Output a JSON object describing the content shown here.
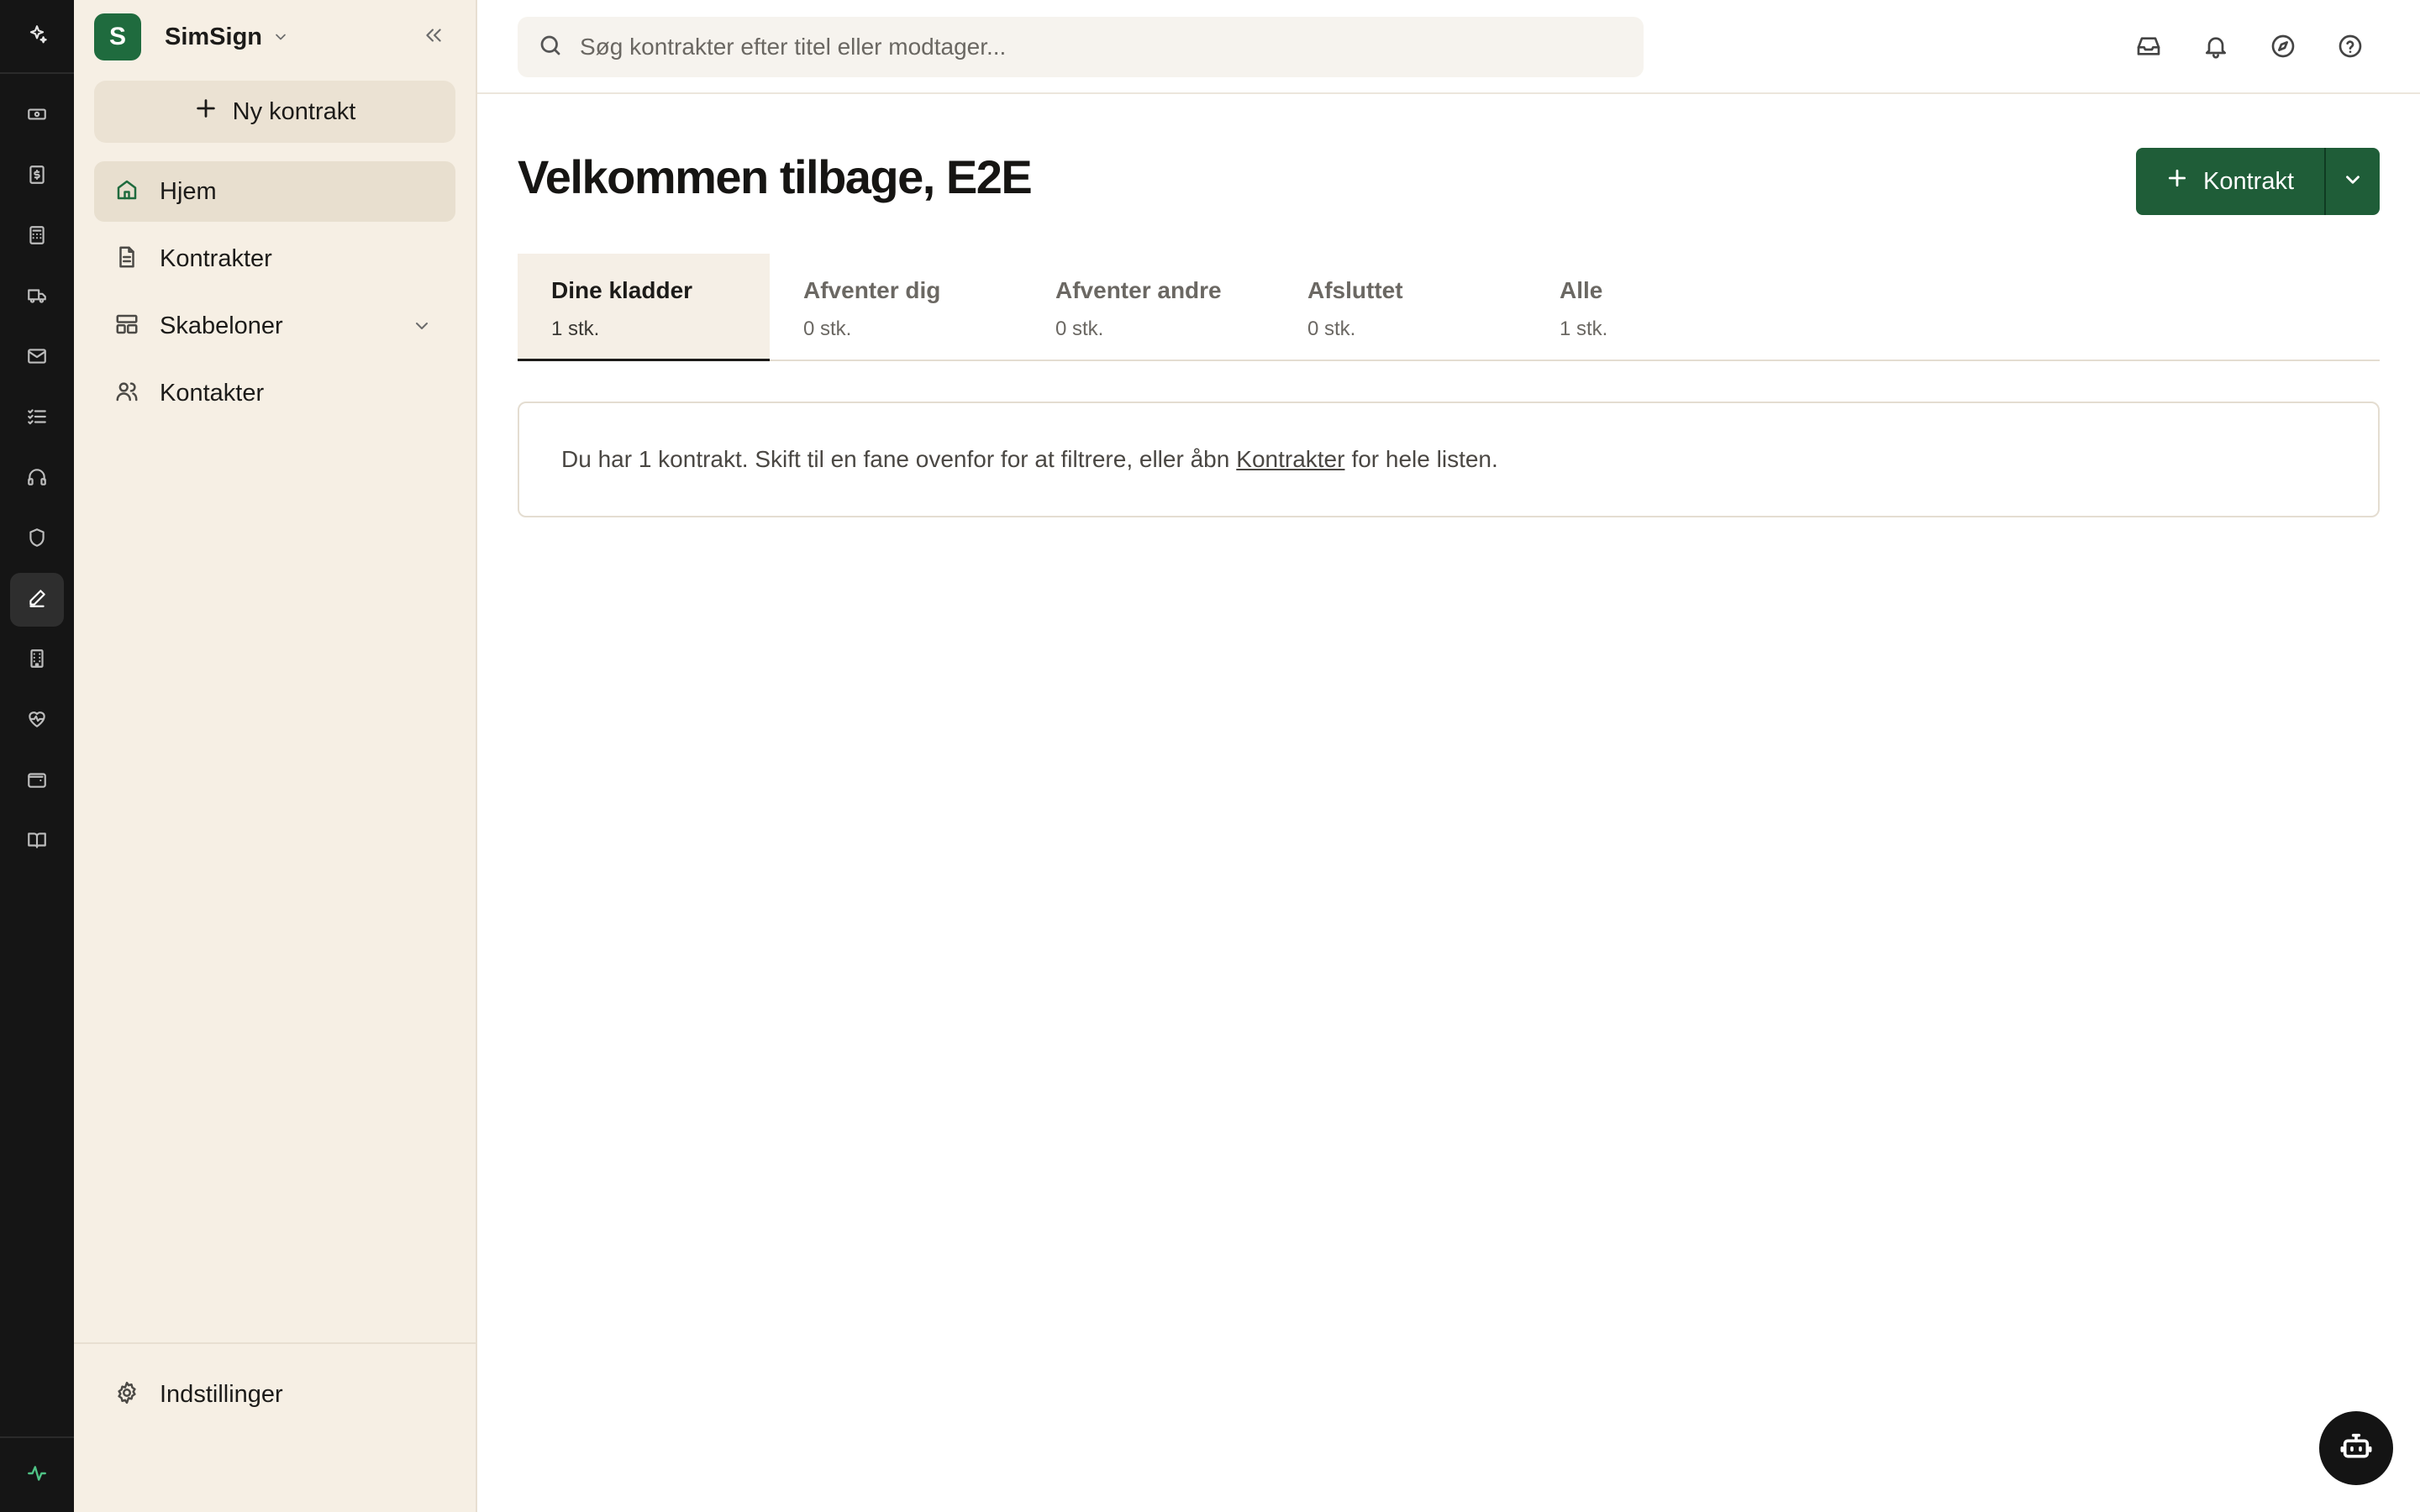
{
  "rail": {
    "logo_icon": "sparkle-icon",
    "items": [
      {
        "name": "banknote-icon"
      },
      {
        "name": "dollar-document-icon"
      },
      {
        "name": "calculator-icon"
      },
      {
        "name": "truck-icon"
      },
      {
        "name": "mail-icon"
      },
      {
        "name": "checklist-icon"
      },
      {
        "name": "headset-icon"
      },
      {
        "name": "shield-icon"
      },
      {
        "name": "pen-icon",
        "active": true
      },
      {
        "name": "building-icon"
      },
      {
        "name": "heart-pulse-icon"
      },
      {
        "name": "wallet-icon"
      },
      {
        "name": "book-icon"
      }
    ],
    "status_icon": "activity-icon",
    "status_color": "#4fc285"
  },
  "sidebar": {
    "workspace_initial": "S",
    "workspace_name": "SimSign",
    "new_button_label": "Ny kontrakt",
    "items": [
      {
        "label": "Hjem",
        "icon": "home-icon",
        "active": true
      },
      {
        "label": "Kontrakter",
        "icon": "document-icon"
      },
      {
        "label": "Skabeloner",
        "icon": "layout-template-icon",
        "expandable": true
      },
      {
        "label": "Kontakter",
        "icon": "users-icon"
      }
    ],
    "settings_label": "Indstillinger"
  },
  "topbar": {
    "search_placeholder": "Søg kontrakter efter titel eller modtager..."
  },
  "main": {
    "title": "Velkommen tilbage, E2E",
    "primary_button_label": "Kontrakt",
    "tabs": [
      {
        "label": "Dine kladder",
        "count": "1 stk.",
        "active": true
      },
      {
        "label": "Afventer dig",
        "count": "0 stk."
      },
      {
        "label": "Afventer andre",
        "count": "0 stk."
      },
      {
        "label": "Afsluttet",
        "count": "0 stk."
      },
      {
        "label": "Alle",
        "count": "1 stk."
      }
    ],
    "info": {
      "before": "Du har 1 kontrakt. Skift til en fane ovenfor for at filtrere, eller åbn",
      "link": "Kontrakter",
      "after": "for hele listen."
    }
  },
  "colors": {
    "brand": "#1f6b3e",
    "primary_button": "#1f5d38",
    "sidebar_bg": "#f6efe4",
    "rail_bg": "#151515"
  }
}
